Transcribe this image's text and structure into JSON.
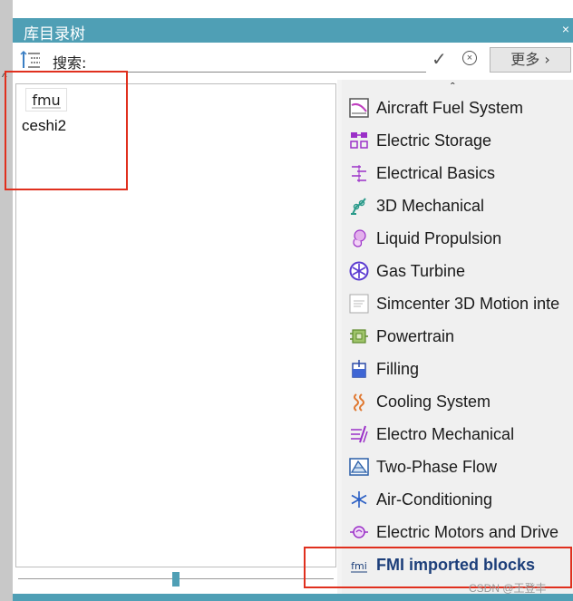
{
  "window": {
    "title": "库目录树",
    "close_glyph": "×"
  },
  "search": {
    "label": "搜索:",
    "value": "",
    "placeholder": "",
    "confirm_glyph": "✓",
    "clear_glyph": "×",
    "more_label": "更多 ›"
  },
  "tree": {
    "nodes": [
      {
        "icon": "fmu-icon",
        "label": "ceshi2"
      }
    ]
  },
  "categories": {
    "scroll_glyph": "ˆ",
    "items": [
      {
        "label": "Aircraft Fuel System",
        "icon": "aircraft-fuel-icon"
      },
      {
        "label": "Electric Storage",
        "icon": "electric-storage-icon"
      },
      {
        "label": "Electrical Basics",
        "icon": "electrical-basics-icon"
      },
      {
        "label": "3D Mechanical",
        "icon": "mechanical-3d-icon"
      },
      {
        "label": "Liquid Propulsion",
        "icon": "liquid-propulsion-icon"
      },
      {
        "label": "Gas Turbine",
        "icon": "gas-turbine-icon"
      },
      {
        "label": "Simcenter 3D Motion inte",
        "icon": "motion-interface-icon"
      },
      {
        "label": "Powertrain",
        "icon": "powertrain-icon"
      },
      {
        "label": "Filling",
        "icon": "filling-icon"
      },
      {
        "label": "Cooling System",
        "icon": "cooling-system-icon"
      },
      {
        "label": "Electro Mechanical",
        "icon": "electro-mechanical-icon"
      },
      {
        "label": "Two-Phase Flow",
        "icon": "two-phase-flow-icon"
      },
      {
        "label": "Air-Conditioning",
        "icon": "air-conditioning-icon"
      },
      {
        "label": "Electric Motors and Drive",
        "icon": "electric-motors-icon"
      },
      {
        "label": "FMI imported blocks",
        "icon": "fmi-icon"
      }
    ]
  },
  "watermark": "CSDN @王登丰",
  "colors": {
    "accent": "#4f9fb5",
    "highlight": "#e0301e"
  }
}
